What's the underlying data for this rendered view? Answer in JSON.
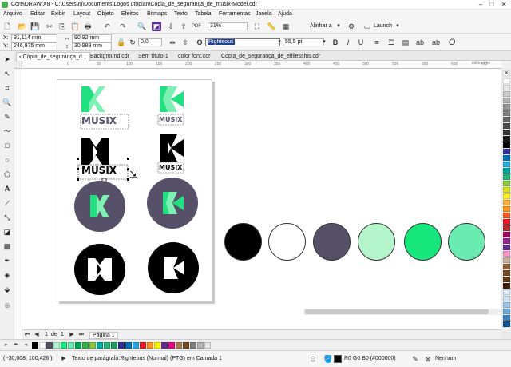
{
  "window": {
    "title": "CorelDRAW X8 - C:\\Users\\nj\\Documents\\Logos utopian\\Cópia_de_segurança_de_musix-Model.cdr"
  },
  "menu": [
    "Arquivo",
    "Editar",
    "Exibir",
    "Layout",
    "Objeto",
    "Efeitos",
    "Bitmaps",
    "Texto",
    "Tabela",
    "Ferramentas",
    "Janela",
    "Ajuda"
  ],
  "toolbar": {
    "zoom": "31%",
    "snap_label": "Alinhar a",
    "launch_label": "Launch"
  },
  "property_bar": {
    "x": "91,114 mm",
    "y": "246,975 mm",
    "w": "90,92 mm",
    "h": "30,989 mm",
    "rotation": "0,0",
    "font_name": "Righteous",
    "font_size": "55,5 pt",
    "x_label": "X:",
    "y_label": "Y:"
  },
  "tabs": [
    "Cópia_de_segurança_d...",
    "Background.cdr",
    "Sem título-1",
    "color font.cdr",
    "Cópia_de_segurança_de_elfilesshis.cdr"
  ],
  "ruler_labels": [
    "0",
    "50",
    "100",
    "150",
    "200",
    "250",
    "300",
    "350",
    "400",
    "450",
    "500",
    "550",
    "600",
    "650",
    "700",
    "750"
  ],
  "ruler_unit": "milímetros",
  "logos": {
    "wordmark": "MUSIX"
  },
  "color_swatches": [
    "#000000",
    "#ffffff",
    "#565068",
    "#b5f5cc",
    "#17e67c",
    "#6aebb0"
  ],
  "colors": {
    "green_light": "#7ef0b4",
    "green": "#21e07f",
    "dark_purple": "#565068"
  },
  "page_nav": {
    "current": "1",
    "of_label": "de",
    "total": "1",
    "page_tab": "Página 1"
  },
  "status": {
    "coords": "( -30,008; 100,426 )",
    "object_info": "Texto de parágrafo:Righteous (Normal) (PTG) em Camada 1",
    "fill_info": "R0 G0 B0 (#000000)",
    "outline_info": "Nenhum"
  },
  "palette_colors": [
    "#ffffff",
    "#e6e6e6",
    "#cccccc",
    "#b3b3b3",
    "#999999",
    "#808080",
    "#666666",
    "#4d4d4d",
    "#333333",
    "#1a1a1a",
    "#000000",
    "#2e3192",
    "#0071bc",
    "#29abe2",
    "#00a99d",
    "#22b573",
    "#8cc63f",
    "#d9e021",
    "#fcee21",
    "#fbb03b",
    "#f7931e",
    "#f15a24",
    "#ed1c24",
    "#c1272d",
    "#9e005d",
    "#92278f",
    "#662d91",
    "#ff99cc",
    "#c7b299",
    "#8c6239",
    "#754c24",
    "#603813",
    "#42210b",
    "#e0ecf8",
    "#cfe2f3",
    "#9fc5e8",
    "#6fa8dc",
    "#3d85c6",
    "#0b5394"
  ],
  "doc_palette_colors": [
    "#000000",
    "#ffffff",
    "#565068",
    "#b5f5cc",
    "#17e67c",
    "#6aebb0",
    "#00a651",
    "#39b54a",
    "#8dc63f",
    "#00a99d",
    "#2bb673",
    "#1b9e5a",
    "#2e3192",
    "#0072bc",
    "#29abe2",
    "#ed1c24",
    "#f7941d",
    "#fff200",
    "#662d91",
    "#ec008c",
    "#a67c52",
    "#754c24",
    "#808080",
    "#b3b3b3",
    "#e6e6e6"
  ]
}
